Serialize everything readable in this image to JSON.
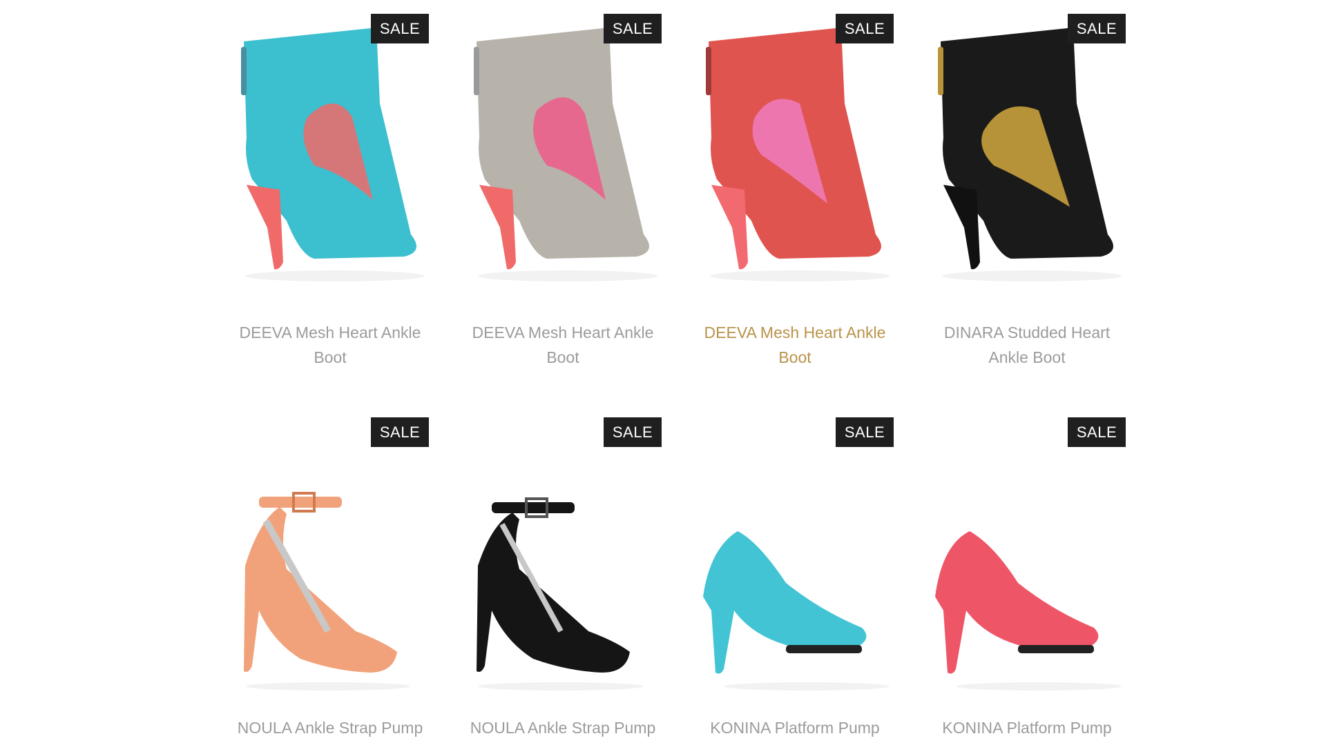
{
  "products": [
    {
      "name": "DEEVA Mesh Heart Ankle Boot",
      "badge": "SALE",
      "shoe_color": "#3cbfcf",
      "accent_color": "#f06a6a",
      "icon": "turquoise-ankle-boot"
    },
    {
      "name": "DEEVA Mesh Heart Ankle Boot",
      "badge": "SALE",
      "shoe_color": "#b7b3ab",
      "accent_color": "#f05a8a",
      "icon": "grey-ankle-boot"
    },
    {
      "name": "DEEVA Mesh Heart Ankle Boot",
      "badge": "SALE",
      "shoe_color": "#e0544f",
      "accent_color": "#f07ab8",
      "icon": "red-ankle-boot"
    },
    {
      "name": "DINARA Studded Heart Ankle Boot",
      "badge": "SALE",
      "shoe_color": "#1a1a1a",
      "accent_color": "#c8a03c",
      "icon": "black-studded-ankle-boot"
    },
    {
      "name": "NOULA Ankle Strap Pump",
      "badge": "SALE",
      "shoe_color": "#f2a27a",
      "accent_color": "#c0c0c0",
      "icon": "peach-ankle-strap-pump"
    },
    {
      "name": "NOULA Ankle Strap Pump",
      "badge": "SALE",
      "shoe_color": "#151515",
      "accent_color": "#c0c0c0",
      "icon": "black-ankle-strap-pump"
    },
    {
      "name": "KONINA Platform Pump",
      "badge": "SALE",
      "shoe_color": "#42c4d4",
      "accent_color": "#222222",
      "icon": "turquoise-platform-pump"
    },
    {
      "name": "KONINA Platform Pump",
      "badge": "SALE",
      "shoe_color": "#ee5668",
      "accent_color": "#222222",
      "icon": "coral-platform-pump"
    }
  ],
  "hover_color": "#b8934a",
  "text_color": "#9b9b9b"
}
